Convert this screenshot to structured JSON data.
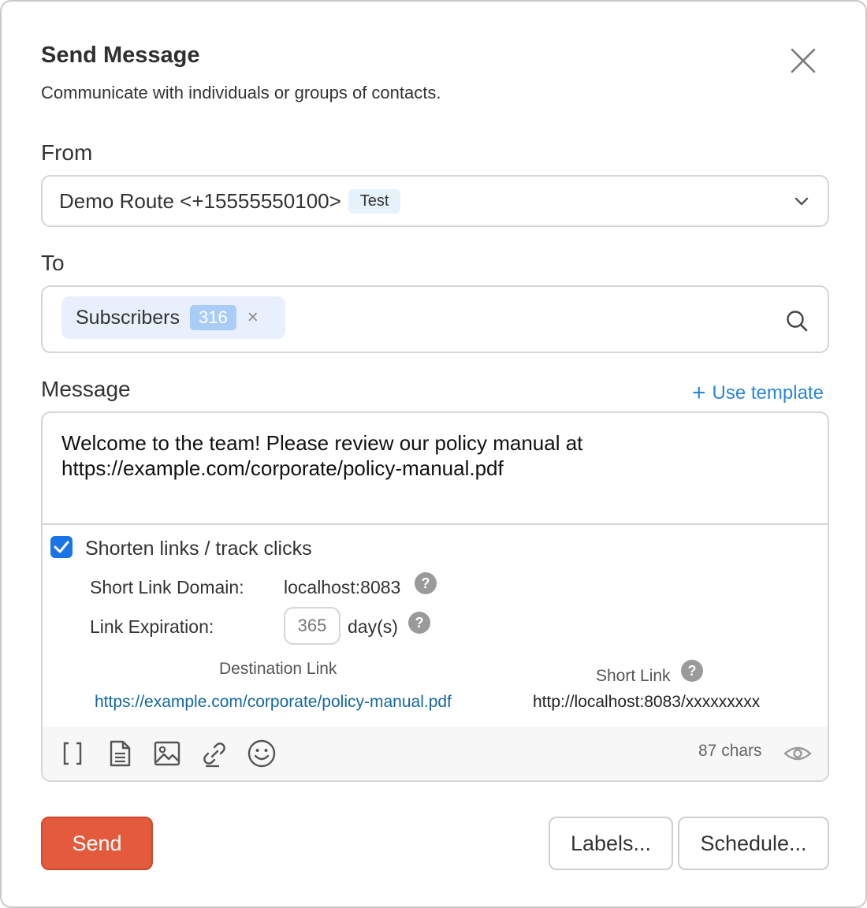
{
  "dialog": {
    "title": "Send Message",
    "subtitle": "Communicate with individuals or groups of contacts."
  },
  "from": {
    "label": "From",
    "selected": "Demo Route <+15555550100>",
    "tag": "Test"
  },
  "to": {
    "label": "To",
    "chip_label": "Subscribers",
    "chip_count": "316",
    "chip_remove": "×"
  },
  "message": {
    "label": "Message",
    "use_template": "Use template",
    "use_template_plus": "+",
    "body": "Welcome to the team! Please review our policy manual at https://example.com/corporate/policy-manual.pdf"
  },
  "shorten": {
    "checked": true,
    "label": "Shorten links / track clicks",
    "domain_label": "Short Link Domain:",
    "domain_value": "localhost:8083",
    "expiration_label": "Link Expiration:",
    "expiration_value": "365",
    "expiration_unit": "day(s)",
    "dest_header": "Destination Link",
    "short_header": "Short Link",
    "dest_link": "https://example.com/corporate/policy-manual.pdf",
    "short_link": "http://localhost:8083/xxxxxxxxx"
  },
  "toolbar": {
    "chars": "87 chars",
    "brackets_glyph": "[ ]",
    "icons": [
      "brackets-icon",
      "document-icon",
      "image-icon",
      "link-icon",
      "emoji-icon",
      "eye-icon"
    ]
  },
  "actions": {
    "send": "Send",
    "labels": "Labels...",
    "schedule": "Schedule..."
  },
  "colors": {
    "accent": "#1a73e8",
    "link": "#2a86d8",
    "send_button": "#e35a3c",
    "tag_bg": "#e7f3fc",
    "chip_bg": "#e7f0fc",
    "chip_count_bg": "#a9cdf7"
  }
}
